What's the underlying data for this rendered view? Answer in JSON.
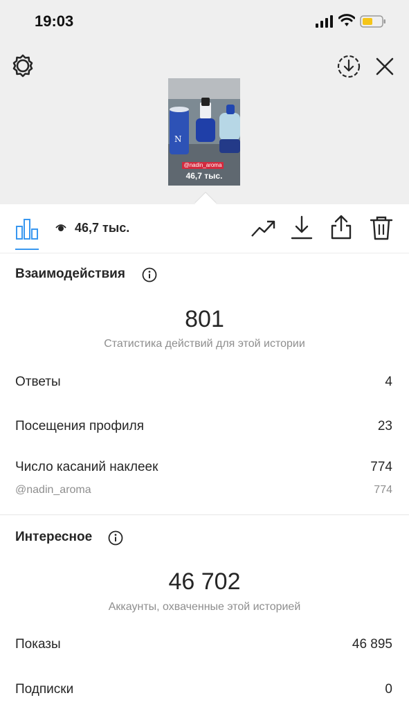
{
  "status_bar": {
    "time": "19:03"
  },
  "story": {
    "sticker_handle": "@nadin_aroma",
    "views_overlay": "46,7 тыс."
  },
  "toolbar": {
    "views": "46,7 тыс."
  },
  "interactions": {
    "title": "Взаимодействия",
    "total": "801",
    "caption": "Статистика действий для этой истории",
    "rows": [
      {
        "label": "Ответы",
        "value": "4"
      },
      {
        "label": "Посещения профиля",
        "value": "23"
      },
      {
        "label": "Число касаний наклеек",
        "value": "774"
      },
      {
        "label": "@nadin_aroma",
        "value": "774"
      }
    ]
  },
  "discovery": {
    "title": "Интересное",
    "total": "46 702",
    "caption": "Аккаунты, охваченные этой историей",
    "rows": [
      {
        "label": "Показы",
        "value": "46 895"
      },
      {
        "label": "Подписки",
        "value": "0"
      }
    ]
  },
  "colors": {
    "accent": "#3897f0",
    "header_bg": "#efefef",
    "muted_text": "#8e8e8e"
  }
}
